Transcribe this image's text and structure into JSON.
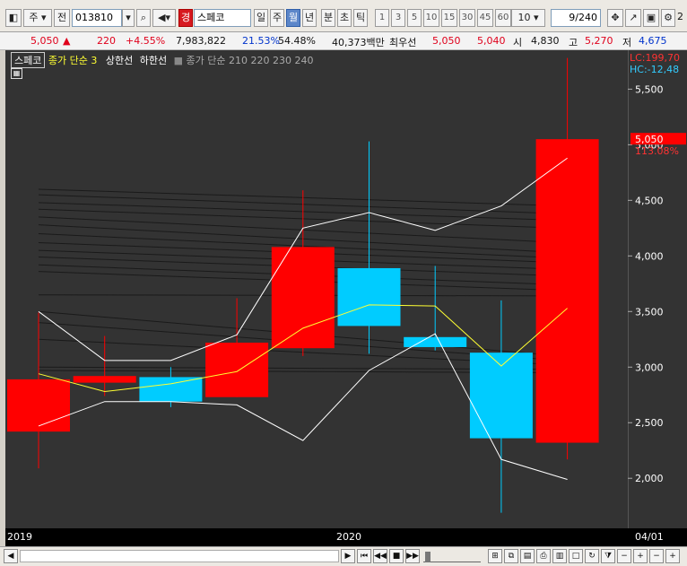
{
  "toolbar": {
    "period_label": "주",
    "prev_label": "전",
    "code": "013810",
    "stock_badge": "경",
    "stock_name": "스페코",
    "tabs": [
      "일",
      "주",
      "월",
      "년",
      "분",
      "초",
      "틱"
    ],
    "active_tab": "월",
    "intervals": [
      "1",
      "3",
      "5",
      "10",
      "15",
      "30",
      "45",
      "60"
    ],
    "interval_value": "10",
    "count": "9/240",
    "right_tail": "2"
  },
  "quote": {
    "price": "5,050",
    "arrow": "▲",
    "change": "220",
    "change_pct": "+4.55%",
    "volume": "7,983,822",
    "vol_ratio": "21.53%",
    "turnover": "54.48%",
    "amount": "40,373백만",
    "best_label": "최우선",
    "best_ask": "5,050",
    "best_bid": "5,040",
    "open_label": "시",
    "open": "4,830",
    "high_label": "고",
    "high": "5,270",
    "low_label": "저",
    "low": "4,675"
  },
  "legend": {
    "name": "스페코",
    "ma3": "종가 단순 3",
    "upper": "상한선",
    "lower": "하한선",
    "ma_long": "종가 단순 210  220  230  240"
  },
  "axis_right": {
    "lc": "LC:199,70",
    "hc": "HC:-12,48",
    "current_price": "5,050",
    "current_pct": "113.08%"
  },
  "x_labels": {
    "left": "2019",
    "mid": "2020",
    "right": "04/01"
  },
  "chart_data": {
    "type": "candlestick",
    "ylim": [
      1550,
      5850
    ],
    "yticks": [
      2000,
      2500,
      3000,
      3500,
      4000,
      4500,
      5000,
      5500
    ],
    "ytick_labels": [
      "2,000",
      "2,500",
      "3,000",
      "3,500",
      "4,000",
      "4,500",
      "5,000",
      "5,500"
    ],
    "candles": [
      {
        "open": 2420,
        "high": 3490,
        "low": 2090,
        "close": 2890,
        "color": "up"
      },
      {
        "open": 2860,
        "high": 3280,
        "low": 2740,
        "close": 2920,
        "color": "up"
      },
      {
        "open": 2910,
        "high": 3000,
        "low": 2640,
        "close": 2690,
        "color": "down"
      },
      {
        "open": 2730,
        "high": 3620,
        "low": 2730,
        "close": 3220,
        "color": "up"
      },
      {
        "open": 3170,
        "high": 4590,
        "low": 3100,
        "close": 4080,
        "color": "up"
      },
      {
        "open": 3890,
        "high": 5030,
        "low": 3120,
        "close": 3370,
        "color": "down"
      },
      {
        "open": 3270,
        "high": 3910,
        "low": 3150,
        "close": 3180,
        "color": "down"
      },
      {
        "open": 3130,
        "high": 3600,
        "low": 1690,
        "close": 2360,
        "color": "down"
      },
      {
        "open": 2320,
        "high": 5780,
        "low": 2170,
        "close": 5050,
        "color": "up"
      }
    ],
    "ma3": [
      null,
      2940,
      2780,
      2850,
      2960,
      3350,
      3560,
      3550,
      3010,
      3530
    ],
    "upper": [
      3500,
      3060,
      3060,
      3290,
      4250,
      4390,
      4230,
      4450,
      4880
    ],
    "lower": [
      2470,
      2690,
      2690,
      2660,
      2340,
      2970,
      3300,
      2170,
      1990
    ],
    "ma_long_series": [
      [
        4600,
        4450
      ],
      [
        4550,
        4380
      ],
      [
        4480,
        4320
      ],
      [
        4420,
        4250
      ],
      [
        4350,
        4120
      ],
      [
        4280,
        4030
      ],
      [
        4200,
        3980
      ],
      [
        4120,
        3940
      ],
      [
        4050,
        3880
      ],
      [
        3990,
        3820
      ],
      [
        3920,
        3740
      ],
      [
        3860,
        3690
      ],
      [
        3650,
        3640
      ],
      [
        3500,
        3100
      ],
      [
        3400,
        3060
      ],
      [
        3250,
        3020
      ],
      [
        3000,
        2980
      ],
      [
        2970,
        2950
      ]
    ]
  },
  "colors": {
    "up": "#ff0000",
    "down": "#00ccff",
    "ma3": "#ffff33",
    "band": "#ffffff",
    "background": "#333333",
    "axis_text": "#ffffff",
    "lc_text": "#ff3333",
    "hc_text": "#33ccff"
  }
}
